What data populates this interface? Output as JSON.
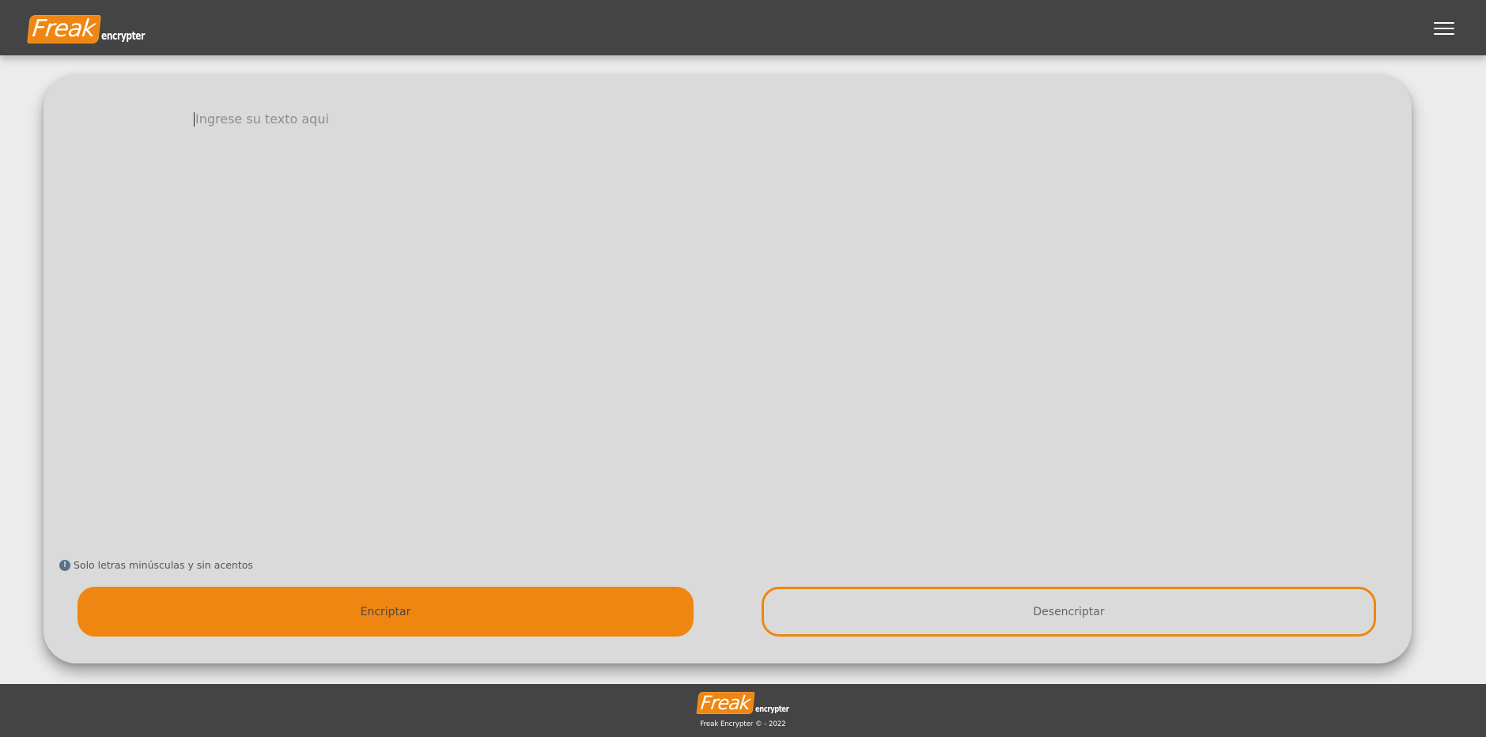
{
  "header": {
    "logo": {
      "word": "Freak",
      "sub": "encrypter"
    },
    "menu_icon": "hamburger-menu-icon"
  },
  "main": {
    "input_placeholder": "Ingrese su texto aqui",
    "hint_icon": "info-icon",
    "hint_icon_glyph": "!",
    "hint": "Solo letras minúsculas y sin acentos",
    "encrypt_label": "Encriptar",
    "decrypt_label": "Desencriptar"
  },
  "footer": {
    "logo": {
      "word": "Freak",
      "sub": "encrypter"
    },
    "copyright": "Freak Encrypter © - 2022"
  },
  "colors": {
    "accent": "#ee8611",
    "header_bg": "#444444",
    "card_bg": "#dadada",
    "page_bg": "#ececec"
  }
}
